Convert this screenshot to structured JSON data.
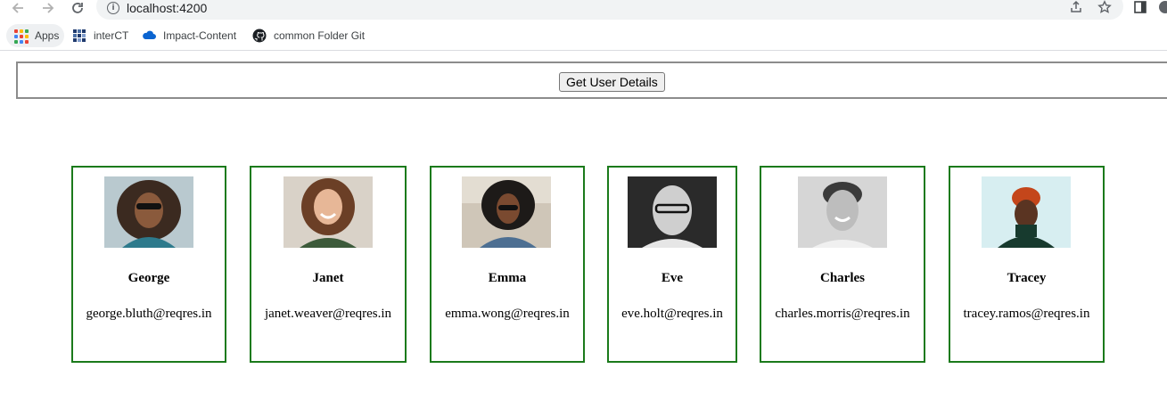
{
  "browser": {
    "url": "localhost:4200",
    "icons": {
      "back": "arrow-left-icon",
      "forward": "arrow-right-icon",
      "reload": "reload-icon",
      "site_info": "info-icon",
      "share": "share-icon",
      "bookmark": "star-icon",
      "side_panel": "side-panel-icon"
    }
  },
  "bookmarks": [
    {
      "label": "Apps",
      "icon": "apps-grid-icon"
    },
    {
      "label": "interCT",
      "icon": "intercept-icon"
    },
    {
      "label": "Impact-Content",
      "icon": "cloud-icon"
    },
    {
      "label": "common Folder Git",
      "icon": "github-icon"
    }
  ],
  "page": {
    "get_button_label": "Get User Details",
    "card_border_color": "#1b7a1b"
  },
  "users": [
    {
      "name": "George",
      "email": "george.bluth@reqres.in"
    },
    {
      "name": "Janet",
      "email": "janet.weaver@reqres.in"
    },
    {
      "name": "Emma",
      "email": "emma.wong@reqres.in"
    },
    {
      "name": "Eve",
      "email": "eve.holt@reqres.in"
    },
    {
      "name": "Charles",
      "email": "charles.morris@reqres.in"
    },
    {
      "name": "Tracey",
      "email": "tracey.ramos@reqres.in"
    }
  ]
}
